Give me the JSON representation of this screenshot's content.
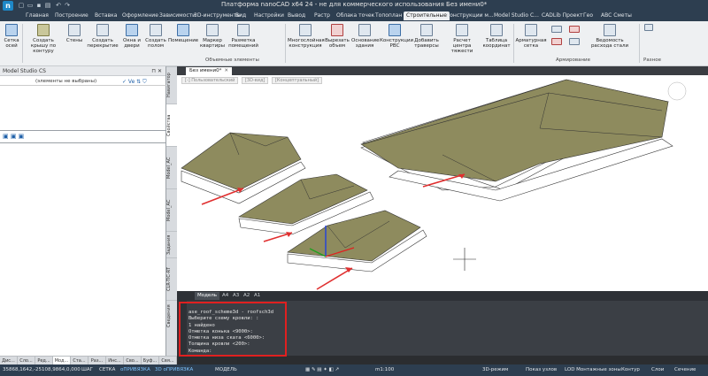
{
  "window": {
    "title": "Платформа nanoCAD x64 24 - не для коммерческого использования Без имени0*",
    "logo": "n"
  },
  "tabs": [
    {
      "label": "Главная"
    },
    {
      "label": "Построение"
    },
    {
      "label": "Вставка"
    },
    {
      "label": "Оформление"
    },
    {
      "label": "Зависимости"
    },
    {
      "label": "3D-инструменты"
    },
    {
      "label": "Вид"
    },
    {
      "label": "Настройки"
    },
    {
      "label": "Вывод"
    },
    {
      "label": "Растр"
    },
    {
      "label": "Облака точек"
    },
    {
      "label": "Топоплан"
    },
    {
      "label": "Строительные"
    },
    {
      "label": "Конструкции м..."
    },
    {
      "label": "Model Studio C..."
    },
    {
      "label": "CADLib Проект"
    },
    {
      "label": "Гео"
    },
    {
      "label": "ABC Сметы"
    }
  ],
  "ribbon": {
    "buttons": [
      {
        "label": "Сетка осей"
      },
      {
        "label": "Создать крышу по контуру"
      },
      {
        "label": "Стены"
      },
      {
        "label": "Создать перекрытие"
      },
      {
        "label": "Окна и двери"
      },
      {
        "label": "Создать полом"
      },
      {
        "label": "Помещение"
      },
      {
        "label": "Маркер квартиры"
      },
      {
        "label": "Разметка помещений"
      },
      {
        "label": "Многослойная конструкция"
      },
      {
        "label": "Вырезать объем"
      },
      {
        "label": "Основание здания"
      },
      {
        "label": "Конструкции РВС"
      },
      {
        "label": "Добавить траверсы"
      },
      {
        "label": "Расчет центра тяжести"
      },
      {
        "label": "Таблица координат"
      },
      {
        "label": "Арматурная сетка"
      },
      {
        "label": "Ведомость расхода стали"
      }
    ],
    "groups": [
      {
        "label": "Объемные элементы"
      },
      {
        "label": "Армирование"
      },
      {
        "label": "Разное"
      }
    ]
  },
  "leftpanel": {
    "title": "Model Studio CS",
    "selection_text": "(элементы не выбраны)",
    "selection_tools": "✓ Ve ⇅ ⛉"
  },
  "sidetabs": [
    {
      "label": "Навигатор"
    },
    {
      "label": "Свойства"
    },
    {
      "label": "Model_АС"
    },
    {
      "label": "Model_АС"
    },
    {
      "label": "Задания"
    },
    {
      "label": "CLR-TIC-RT"
    },
    {
      "label": "Сведения"
    }
  ],
  "document": {
    "tab": "Без имени0*",
    "view_controls": [
      "[-] Пользовательский",
      "[3D-вид]",
      "[Концептуальный]"
    ]
  },
  "modeltabs": [
    {
      "label": "Модель"
    },
    {
      "label": "A4"
    },
    {
      "label": "A3"
    },
    {
      "label": "A2"
    },
    {
      "label": "A1"
    }
  ],
  "command": {
    "lines": [
      "ase_roof_scheme3d - roofsch3d",
      "",
      "Выберите схему кровли: :",
      "1 найдено",
      "Отметка конька <9000>:",
      "Отметка низа ската <6000>:",
      "Толщина кровли <200>:",
      "Команда:"
    ]
  },
  "panelbar": [
    {
      "label": "Дис..."
    },
    {
      "label": "Сло..."
    },
    {
      "label": "Ред..."
    },
    {
      "label": "Мод..."
    },
    {
      "label": "Ста..."
    },
    {
      "label": "Раз..."
    },
    {
      "label": "Инс..."
    },
    {
      "label": "Сво..."
    },
    {
      "label": "Буф..."
    },
    {
      "label": "Свя..."
    }
  ],
  "statusbar": {
    "coords": "35868,1642,-25108,9864,0,000",
    "items": [
      {
        "label": "ШАГ",
        "on": false
      },
      {
        "label": "СЕТКА",
        "on": false
      },
      {
        "label": "оПРИВЯЗКА",
        "on": true
      },
      {
        "label": "3D оПРИВЯЗКА",
        "on": true
      },
      {
        "label": "МОДЕЛЬ",
        "on": false
      }
    ],
    "scale": "m1:100",
    "right_items": [
      {
        "label": "3D-режим"
      },
      {
        "label": "Показ узлов"
      },
      {
        "label": "LOD Монтажные зоны"
      },
      {
        "label": "Контур"
      },
      {
        "label": "Слои"
      },
      {
        "label": "Сечение"
      }
    ]
  }
}
